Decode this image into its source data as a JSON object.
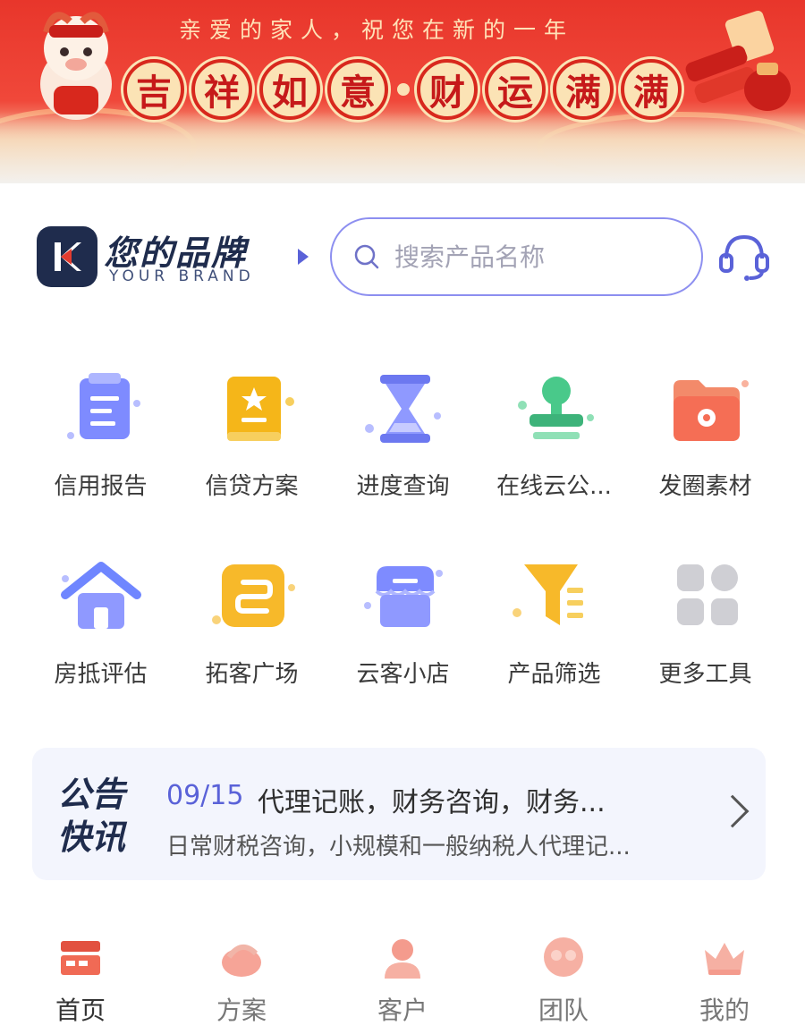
{
  "banner": {
    "subtitle": "亲爱的家人，祝您在新的一年",
    "title_chars": [
      "吉",
      "祥",
      "如",
      "意",
      "财",
      "运",
      "满",
      "满"
    ]
  },
  "brand": {
    "name": "您的品牌",
    "sub": "YOUR BRAND",
    "logo_letter": "K"
  },
  "search": {
    "placeholder": "搜索产品名称"
  },
  "tools": {
    "row1": [
      {
        "label": "信用报告",
        "icon": "document-icon"
      },
      {
        "label": "信贷方案",
        "icon": "book-star-icon"
      },
      {
        "label": "进度查询",
        "icon": "hourglass-icon"
      },
      {
        "label": "在线云公...",
        "icon": "stamp-icon"
      },
      {
        "label": "发圈素材",
        "icon": "folder-icon"
      }
    ],
    "row2": [
      {
        "label": "房抵评估",
        "icon": "house-icon"
      },
      {
        "label": "拓客广场",
        "icon": "customer-expand-icon"
      },
      {
        "label": "云客小店",
        "icon": "shop-icon"
      },
      {
        "label": "产品筛选",
        "icon": "funnel-icon"
      },
      {
        "label": "更多工具",
        "icon": "more-grid-icon"
      }
    ]
  },
  "notice": {
    "tag_line1": "公告",
    "tag_line2": "快讯",
    "date": "09/15",
    "title": "代理记账，财务咨询，财务...",
    "body": "日常财税咨询，小规模和一般纳税人代理记..."
  },
  "tabbar": [
    {
      "label": "首页",
      "icon": "home-icon",
      "active": true
    },
    {
      "label": "方案",
      "icon": "plan-icon",
      "active": false
    },
    {
      "label": "客户",
      "icon": "customer-icon",
      "active": false
    },
    {
      "label": "团队",
      "icon": "team-icon",
      "active": false
    },
    {
      "label": "我的",
      "icon": "crown-icon",
      "active": false
    }
  ],
  "colors": {
    "banner_red": "#e8362b",
    "brand_navy": "#1f2c4d",
    "accent_purple": "#5a62d8",
    "search_border": "#8d8ff0",
    "notice_bg": "#f3f5fd"
  }
}
